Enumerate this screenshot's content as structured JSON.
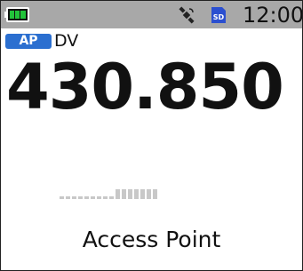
{
  "status_bar": {
    "battery_icon": "battery-full-icon",
    "battery_color": "#22c33a",
    "gps_icon": "gps-satellite-icon",
    "sd_icon": "sd-card-icon",
    "sd_label": "SD",
    "clock": "12:00"
  },
  "mode": {
    "badge": "AP",
    "badge_color": "#2b6fd0",
    "label": "DV"
  },
  "frequency": "430.850",
  "s_meter": {
    "icon": "signal-meter-icon",
    "level": 0
  },
  "bottom_label": "Access Point"
}
